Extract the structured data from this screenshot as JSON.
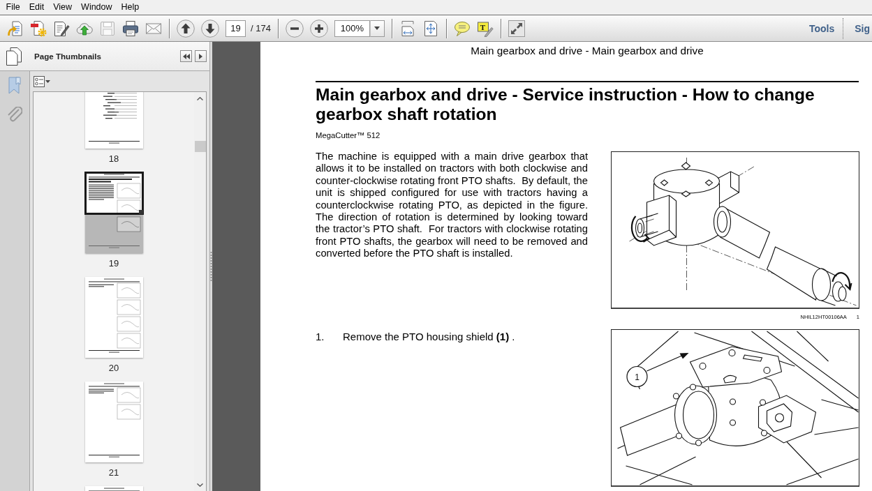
{
  "menu": [
    "File",
    "Edit",
    "View",
    "Window",
    "Help"
  ],
  "toolbar": {
    "save": {
      "disabled": true
    },
    "page_number": "19",
    "page_count": "/ 174",
    "zoom": "100%",
    "text_tool_glyph": "T",
    "panels": [
      {
        "label": "Tools"
      },
      {
        "label": "Sig"
      }
    ]
  },
  "sidebar": {
    "title": "Page Thumbnails",
    "thumbnails": [
      {
        "label": "18",
        "selected": false
      },
      {
        "label": "19",
        "selected": true
      },
      {
        "label": "20",
        "selected": false
      },
      {
        "label": "21",
        "selected": false
      },
      {
        "selected": false
      }
    ]
  },
  "document": {
    "running_header": "Main gearbox and drive - Main gearbox and drive",
    "title": "Main gearbox and drive - Service instruction - How to change gearbox shaft rotation",
    "model": "MegaCutter™ 512",
    "intro": {
      "text": "The machine is equipped with a main drive gearbox that allows it to be installed on tractors with both clockwise and counter-clockwise rotating front PTO shafts.  By default, the unit is shipped configured for use with tractors having a counterclockwise rotating PTO, as depicted in the figure. The direction of rotation is determined by looking toward the tractor’s PTO shaft.  For tractors with clockwise rotating front PTO shafts, the gearbox will need to be removed and converted before the PTO shaft is installed.",
      "figure": {
        "code": "NHIL12HT00106AA",
        "number": "1"
      }
    },
    "steps": [
      {
        "number": "1.",
        "text": "Remove the PTO housing shield **(1)** .",
        "figure": {
          "callout": "1"
        }
      }
    ]
  }
}
